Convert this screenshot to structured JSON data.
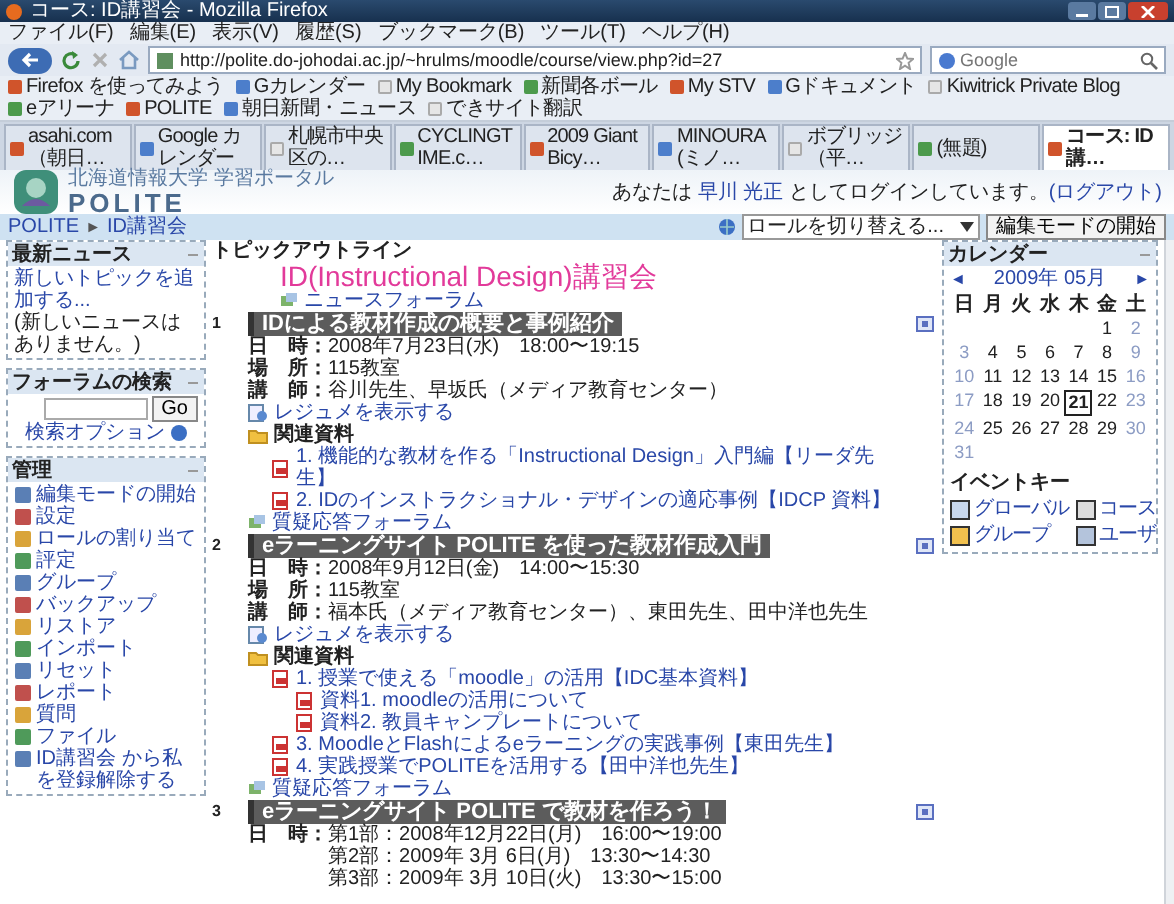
{
  "window": {
    "title": "コース: ID講習会 - Mozilla Firefox"
  },
  "menu": [
    "ファイル(F)",
    "編集(E)",
    "表示(V)",
    "履歴(S)",
    "ブックマーク(B)",
    "ツール(T)",
    "ヘルプ(H)"
  ],
  "toolbar": {
    "url": "http://polite.do-johodai.ac.jp/~hrulms/moodle/course/view.php?id=27",
    "placeholder": "Google"
  },
  "bookmarks": [
    "Firefox を使ってみよう",
    "Gカレンダー",
    "My Bookmark",
    "新聞各ボール",
    "My STV",
    "Gドキュメント",
    "Kiwitrick Private Blog",
    "eアリーナ",
    "POLITE",
    "朝日新聞・ニュース",
    "できサイト翻訳"
  ],
  "tabs": [
    {
      "label": "asahi.com（朝日…",
      "selected": false
    },
    {
      "label": "Google カレンダー",
      "selected": false
    },
    {
      "label": "札幌市中央区の…",
      "selected": false
    },
    {
      "label": "CYCLINGTIME.c…",
      "selected": false
    },
    {
      "label": "2009 Giant Bicy…",
      "selected": false
    },
    {
      "label": "MINOURA (ミノ…",
      "selected": false
    },
    {
      "label": "ボブリッジ（平…",
      "selected": false
    },
    {
      "label": "(無題)",
      "selected": false
    },
    {
      "label": "コース: ID講…",
      "selected": true
    }
  ],
  "header": {
    "subtitle": "北海道情報大学 学習ポータル",
    "logo": "POLITE",
    "login_prefix": "あなたは",
    "user": "早川 光正",
    "login_suffix": "としてログインしています。",
    "logout": "(ログアウト)"
  },
  "navbar": {
    "breadcrumb": [
      "POLITE",
      "ID講習会"
    ],
    "separator": "►",
    "role_select": "ロールを切り替える...",
    "edit_button": "編集モードの開始"
  },
  "left_blocks": [
    {
      "kind": "news",
      "title": "最新ニュース",
      "link": "新しいトピックを追加する...",
      "note": "(新しいニュースはありません。)"
    },
    {
      "kind": "search",
      "title": "フォーラムの検索",
      "button": "Go",
      "link": "検索オプション"
    },
    {
      "kind": "admin",
      "title": "管理",
      "items": [
        "編集モードの開始",
        "設定",
        "ロールの割り当て",
        "評定",
        "グループ",
        "バックアップ",
        "リストア",
        "インポート",
        "リセット",
        "レポート",
        "質問",
        "ファイル",
        "ID講習会 から私を登録解除する"
      ]
    }
  ],
  "course": {
    "heading": "トピックアウトライン",
    "title": "ID(Instructional Design)講習会",
    "news_forum": "ニュースフォーラム",
    "sections": [
      {
        "number": "1",
        "title": "IDによる教材作成の概要と事例紹介",
        "details": [
          {
            "label": "日　時：",
            "lines": [
              "2008年7月23日(水)　18:00〜19:15"
            ]
          },
          {
            "label": "場　所：",
            "lines": [
              "115教室"
            ]
          },
          {
            "label": "講　師：",
            "lines": [
              "谷川先生、早坂氏（メディア教育センター）"
            ]
          }
        ],
        "resume": "レジュメを表示する",
        "materials_title": "関連資料",
        "materials": [
          {
            "text": "1. 機能的な教材を作る「Instructional Design」入門編【リーダ先生】"
          },
          {
            "text": "2. IDのインストラクショナル・デザインの適応事例【IDCP 資料】"
          }
        ],
        "forum": "質疑応答フォーラム"
      },
      {
        "number": "2",
        "title": "eラーニングサイト POLITE を使った教材作成入門",
        "details": [
          {
            "label": "日　時：",
            "lines": [
              "2008年9月12日(金)　14:00〜15:30"
            ]
          },
          {
            "label": "場　所：",
            "lines": [
              "115教室"
            ]
          },
          {
            "label": "講　師：",
            "lines": [
              "福本氏（メディア教育センター）、東田先生、田中洋也先生"
            ]
          }
        ],
        "resume": "レジュメを表示する",
        "materials_title": "関連資料",
        "materials": [
          {
            "text": "1. 授業で使える「moodle」の活用【IDC基本資料】",
            "children": [
              {
                "text": "資料1. moodleの活用について"
              },
              {
                "text": "資料2. 教員キャンプレートについて"
              }
            ]
          },
          {
            "text": "3. MoodleとFlashによるeラーニングの実践事例【東田先生】"
          },
          {
            "text": "4. 実践授業でPOLITEを活用する【田中洋也先生】"
          }
        ],
        "forum": "質疑応答フォーラム"
      },
      {
        "number": "3",
        "title": "eラーニングサイト POLITE で教材を作ろう！",
        "details": [
          {
            "label": "日　時：",
            "lines": [
              "第1部：2008年12月22日(月)　16:00〜19:00",
              "第2部：2009年 3月 6日(月)　13:30〜14:30",
              "第3部：2009年 3月 10日(火)　13:30〜15:00"
            ]
          }
        ]
      }
    ]
  },
  "calendar": {
    "title": "カレンダー",
    "prev": "◄",
    "next": "►",
    "month": "2009年 05月",
    "weekdays": [
      "日",
      "月",
      "火",
      "水",
      "木",
      "金",
      "土"
    ],
    "weeks": [
      [
        {
          "kind": "blank"
        },
        {
          "kind": "blank"
        },
        {
          "kind": "blank"
        },
        {
          "kind": "blank"
        },
        {
          "kind": "blank"
        },
        {
          "day": "1",
          "weekend": false,
          "today": false
        },
        {
          "day": "2",
          "weekend": true,
          "today": false
        }
      ],
      [
        {
          "day": "3",
          "weekend": true,
          "today": false
        },
        {
          "day": "4",
          "weekend": false,
          "today": false
        },
        {
          "day": "5",
          "weekend": false,
          "today": false
        },
        {
          "day": "6",
          "weekend": false,
          "today": false
        },
        {
          "day": "7",
          "weekend": false,
          "today": false
        },
        {
          "day": "8",
          "weekend": false,
          "today": false
        },
        {
          "day": "9",
          "weekend": true,
          "today": false
        }
      ],
      [
        {
          "day": "10",
          "weekend": true,
          "today": false
        },
        {
          "day": "11",
          "weekend": false,
          "today": false
        },
        {
          "day": "12",
          "weekend": false,
          "today": false
        },
        {
          "day": "13",
          "weekend": false,
          "today": false
        },
        {
          "day": "14",
          "weekend": false,
          "today": false
        },
        {
          "day": "15",
          "weekend": false,
          "today": false
        },
        {
          "day": "16",
          "weekend": true,
          "today": false
        }
      ],
      [
        {
          "day": "17",
          "weekend": true,
          "today": false
        },
        {
          "day": "18",
          "weekend": false,
          "today": false
        },
        {
          "day": "19",
          "weekend": false,
          "today": false
        },
        {
          "day": "20",
          "weekend": false,
          "today": false
        },
        {
          "day": "21",
          "weekend": false,
          "today": true
        },
        {
          "day": "22",
          "weekend": false,
          "today": false
        },
        {
          "day": "23",
          "weekend": true,
          "today": false
        }
      ],
      [
        {
          "day": "24",
          "weekend": true,
          "today": false
        },
        {
          "day": "25",
          "weekend": false,
          "today": false
        },
        {
          "day": "26",
          "weekend": false,
          "today": false
        },
        {
          "day": "27",
          "weekend": false,
          "today": false
        },
        {
          "day": "28",
          "weekend": false,
          "today": false
        },
        {
          "day": "29",
          "weekend": false,
          "today": false
        },
        {
          "day": "30",
          "weekend": true,
          "today": false
        }
      ],
      [
        {
          "day": "31",
          "weekend": true,
          "today": false
        }
      ]
    ],
    "events_title": "イベントキー",
    "events": [
      {
        "label": "グローバル",
        "color": "#c9d8ee"
      },
      {
        "label": "コース",
        "color": "#dcdcdc"
      },
      {
        "label": "グループ",
        "color": "#f2c14e"
      },
      {
        "label": "ユーザ",
        "color": "#b4c4dc"
      }
    ]
  }
}
